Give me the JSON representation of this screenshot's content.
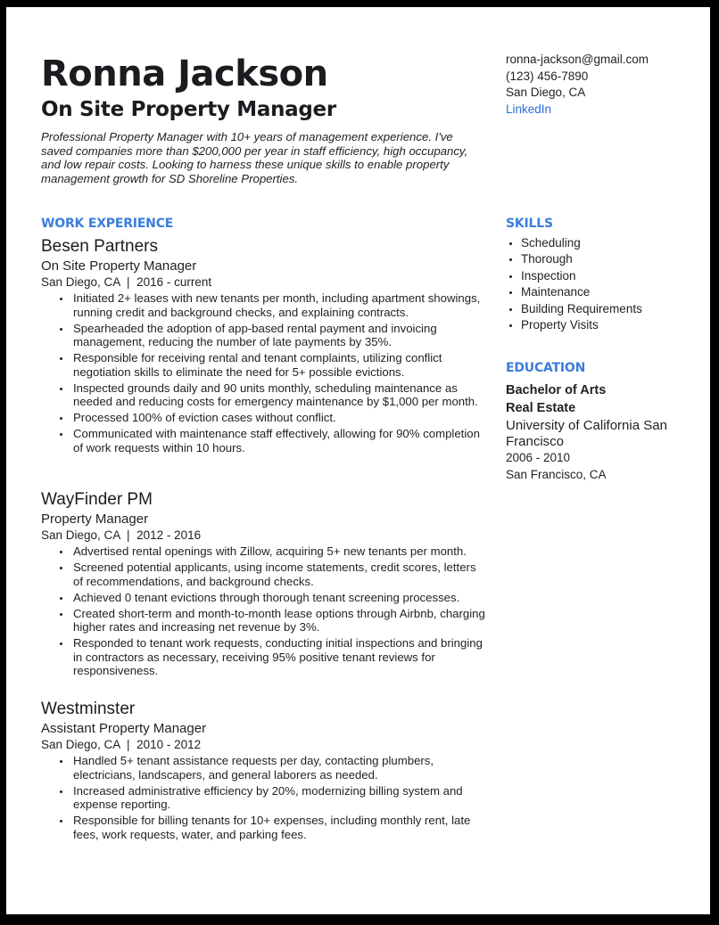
{
  "header": {
    "name": "Ronna Jackson",
    "title": "On Site Property Manager",
    "summary": "Professional Property Manager with 10+ years of management experience. I've saved companies more than $200,000 per year in staff efficiency, high occupancy, and low repair costs. Looking to harness these unique skills to enable property management growth for SD Shoreline Properties."
  },
  "contact": {
    "email": "ronna-jackson@gmail.com",
    "phone": "(123) 456-7890",
    "location": "San Diego, CA",
    "linkedin": "LinkedIn"
  },
  "colors": {
    "accent": "#3b7ddd",
    "link": "#2a6fd6",
    "text": "#1f2023",
    "border": "#000000"
  },
  "work": {
    "heading": "WORK EXPERIENCE",
    "jobs": [
      {
        "company": "Besen Partners",
        "role": "On Site Property Manager",
        "meta": "San Diego, CA  |  2016 - current",
        "bullets": [
          "Initiated 2+ leases with new tenants per month, including apartment showings, running credit and background checks, and explaining contracts.",
          "Spearheaded the adoption of app-based rental payment and invoicing management, reducing the number of late payments by 35%.",
          "Responsible for receiving rental and tenant complaints, utilizing conflict negotiation skills to eliminate the need for 5+ possible evictions.",
          "Inspected grounds daily and 90 units monthly, scheduling maintenance as needed and reducing costs for emergency maintenance by $1,000 per month.",
          "Processed 100% of eviction cases without conflict.",
          "Communicated with maintenance staff effectively, allowing for 90% completion of work requests within 10 hours."
        ]
      },
      {
        "company": "WayFinder PM",
        "role": "Property Manager",
        "meta": "San Diego, CA  |  2012 - 2016",
        "bullets": [
          "Advertised rental openings with Zillow, acquiring 5+ new tenants per month.",
          "Screened potential applicants, using income statements, credit scores, letters of recommendations, and background checks.",
          "Achieved 0 tenant evictions through thorough tenant screening processes.",
          "Created short-term and month-to-month lease options through Airbnb, charging higher rates and increasing net revenue by 3%.",
          "Responded to tenant work requests, conducting initial inspections and bringing in contractors as necessary, receiving 95% positive tenant reviews for responsiveness."
        ]
      },
      {
        "company": "Westminster",
        "role": "Assistant Property Manager",
        "meta": "San Diego, CA  |  2010 - 2012",
        "bullets": [
          "Handled 5+ tenant assistance requests per day, contacting plumbers, electricians, landscapers, and general laborers as needed.",
          "Increased administrative efficiency by 20%, modernizing billing system and expense reporting.",
          "Responsible for billing tenants for 10+ expenses, including monthly rent, late fees, work requests, water, and parking fees."
        ]
      }
    ]
  },
  "skills": {
    "heading": "SKILLS",
    "items": [
      "Scheduling",
      "Thorough",
      "Inspection",
      "Maintenance",
      "Building Requirements",
      "Property Visits"
    ]
  },
  "education": {
    "heading": "EDUCATION",
    "degree": "Bachelor of Arts",
    "major": "Real Estate",
    "school": "University of California San Francisco",
    "years": "2006 - 2010",
    "location": "San Francisco, CA"
  }
}
